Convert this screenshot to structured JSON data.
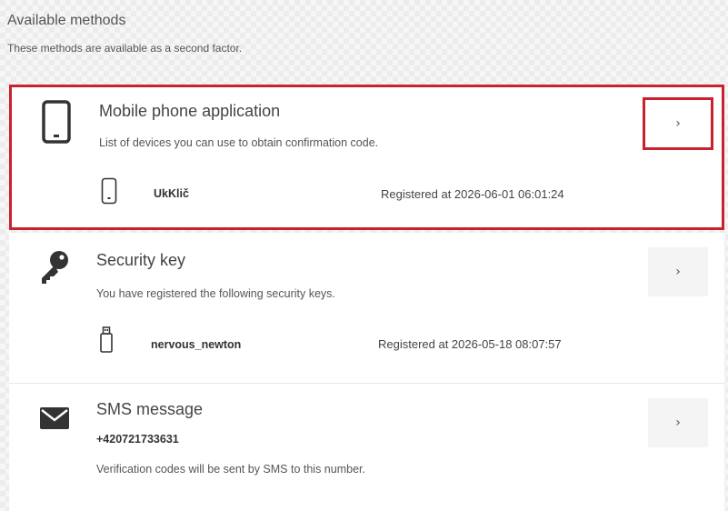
{
  "header": {
    "title": "Available methods",
    "subtitle": "These methods are available as a second factor."
  },
  "methods": [
    {
      "icon": "mobile-phone-icon",
      "title": "Mobile phone application",
      "description": "List of devices you can use to obtain confirmation code.",
      "device": {
        "icon": "phone-device-icon",
        "name": "UkKlič",
        "registered": "Registered at 2026-06-01 06:01:24"
      },
      "action_label": "›"
    },
    {
      "icon": "key-icon",
      "title": "Security key",
      "description": "You have registered the following security keys.",
      "device": {
        "icon": "usb-key-icon",
        "name": "nervous_newton",
        "registered": "Registered at 2026-05-18 08:07:57"
      },
      "action_label": "›"
    },
    {
      "icon": "envelope-icon",
      "title": "SMS message",
      "number": "+420721733631",
      "description": "Verification codes will be sent by SMS to this number.",
      "action_label": "›"
    }
  ],
  "colors": {
    "highlight": "#c9222f"
  }
}
